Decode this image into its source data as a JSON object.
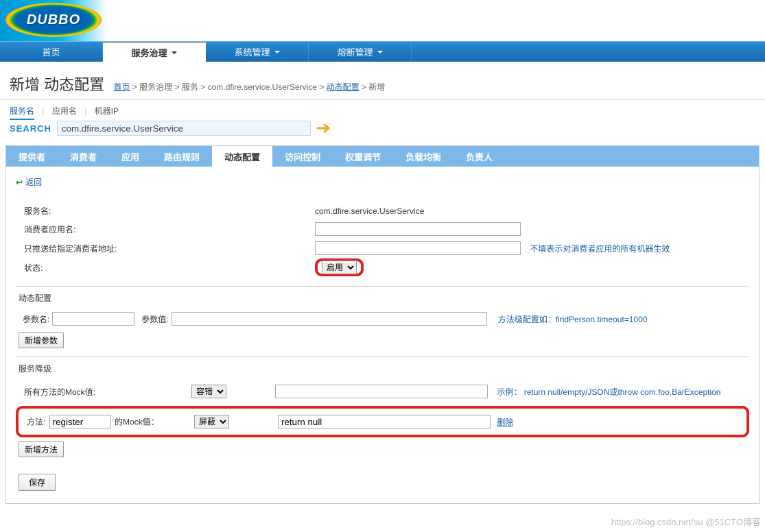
{
  "brand": {
    "name": "DUBBO"
  },
  "nav": {
    "items": [
      {
        "label": "首页"
      },
      {
        "label": "服务治理",
        "active": true
      },
      {
        "label": "系统管理"
      },
      {
        "label": "熔断管理"
      }
    ]
  },
  "page": {
    "title": "新增 动态配置",
    "breadcrumb": {
      "home": "首页",
      "gov": "服务治理",
      "svc": "服务",
      "svc_name": "com.dfire.service.UserService",
      "dyn": "动态配置",
      "add": "新增"
    }
  },
  "view_tabs": {
    "service": "服务名",
    "app": "应用名",
    "ip": "机器IP"
  },
  "search": {
    "label": "SEARCH",
    "value": "com.dfire.service.UserService"
  },
  "inner_tabs": [
    "提供者",
    "消费者",
    "应用",
    "路由规则",
    "动态配置",
    "访问控制",
    "权重调节",
    "负载均衡",
    "负责人"
  ],
  "inner_active_index": 4,
  "back_label": "返回",
  "form": {
    "service_label": "服务名:",
    "service_value": "com.dfire.service.UserService",
    "consumer_app_label": "消费者应用名:",
    "consumer_app_value": "",
    "push_addr_label": "只推送给指定消费者地址:",
    "push_addr_value": "",
    "push_addr_hint": "不填表示对消费者应用的所有机器生效",
    "status_label": "状态:",
    "status_options": [
      "启用"
    ],
    "status_value": "启用"
  },
  "dynamic": {
    "title": "动态配置",
    "param_name_label": "参数名:",
    "param_name_value": "",
    "param_value_label": "参数值:",
    "param_value_value": "",
    "param_hint": "方法级配置如：findPerson.timeout=1000",
    "add_param_btn": "新增参数"
  },
  "degrade": {
    "title": "服务降级",
    "all_mock_label": "所有方法的Mock值:",
    "all_mock_select": "容错",
    "all_mock_value": "",
    "all_mock_hint_prefix": "示例：",
    "all_mock_hint": "return null/empty/JSON或throw com.foo.BarException",
    "method_label_prefix": "方法:",
    "method_name": "register",
    "method_label_suffix": "的Mock值：",
    "method_select": "屏蔽",
    "method_value": "return null",
    "delete_label": "删除",
    "add_method_btn": "新增方法"
  },
  "save_btn": "保存",
  "watermark": "https://blog.csdn.net/su  @51CTO博客"
}
